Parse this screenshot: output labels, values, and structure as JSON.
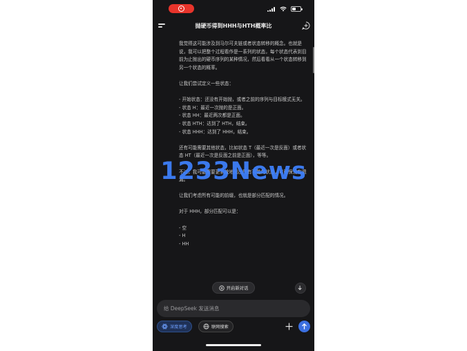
{
  "app": {
    "title": "抛硬币得到HHH与HTH概率比",
    "colors": {
      "accent": "#3b6fe0",
      "background": "#161618",
      "recording": "#e8342b"
    }
  },
  "status_bar": {
    "icons": [
      "recording-indicator-icon",
      "signal-icon",
      "wifi-icon",
      "battery-icon"
    ]
  },
  "message": {
    "paragraphs": [
      "我觉得这可能涉及到马尔可夫链或者状态转移的概念。也就是说，我可以把整个过程看作是一系列的状态，每个状态代表到目前为止抛出的硬币序列的某种情况，然后看看从一个状态转移到另一个状态的概率。",
      "让我们尝试定义一些状态："
    ],
    "states": [
      "- 开始状态：还没有开始抛，或者之前的序列与目标模式无关。",
      "- 状态 H：最近一次抛的是正面。",
      "- 状态 HH：最近两次都是正面。",
      "- 状态 HTH：达到了 HTH，结束。",
      "- 状态 HHH：达到了 HHH，结束。"
    ],
    "paragraphs_after": [
      "还有可能需要其他状态，比如状态 T（最近一次是反面）或者状态 HT（最近一次是反面之前是正面），等等。",
      "不过，我可能需要更系统地列出所有可能的状态，以确保没有遗漏。",
      "让我们考虑所有可能的前缀，也就是部分匹配的情况。",
      "对于 HHH，部分匹配可以是："
    ],
    "prefixes": [
      "- 空",
      "- H",
      "- HH"
    ]
  },
  "watermark": "1233News",
  "new_conversation_label": "开启新对话",
  "input": {
    "placeholder": "给 DeepSeek 发送消息"
  },
  "toolbar": {
    "deep_think_label": "深度思考",
    "web_search_label": "联网搜索"
  }
}
